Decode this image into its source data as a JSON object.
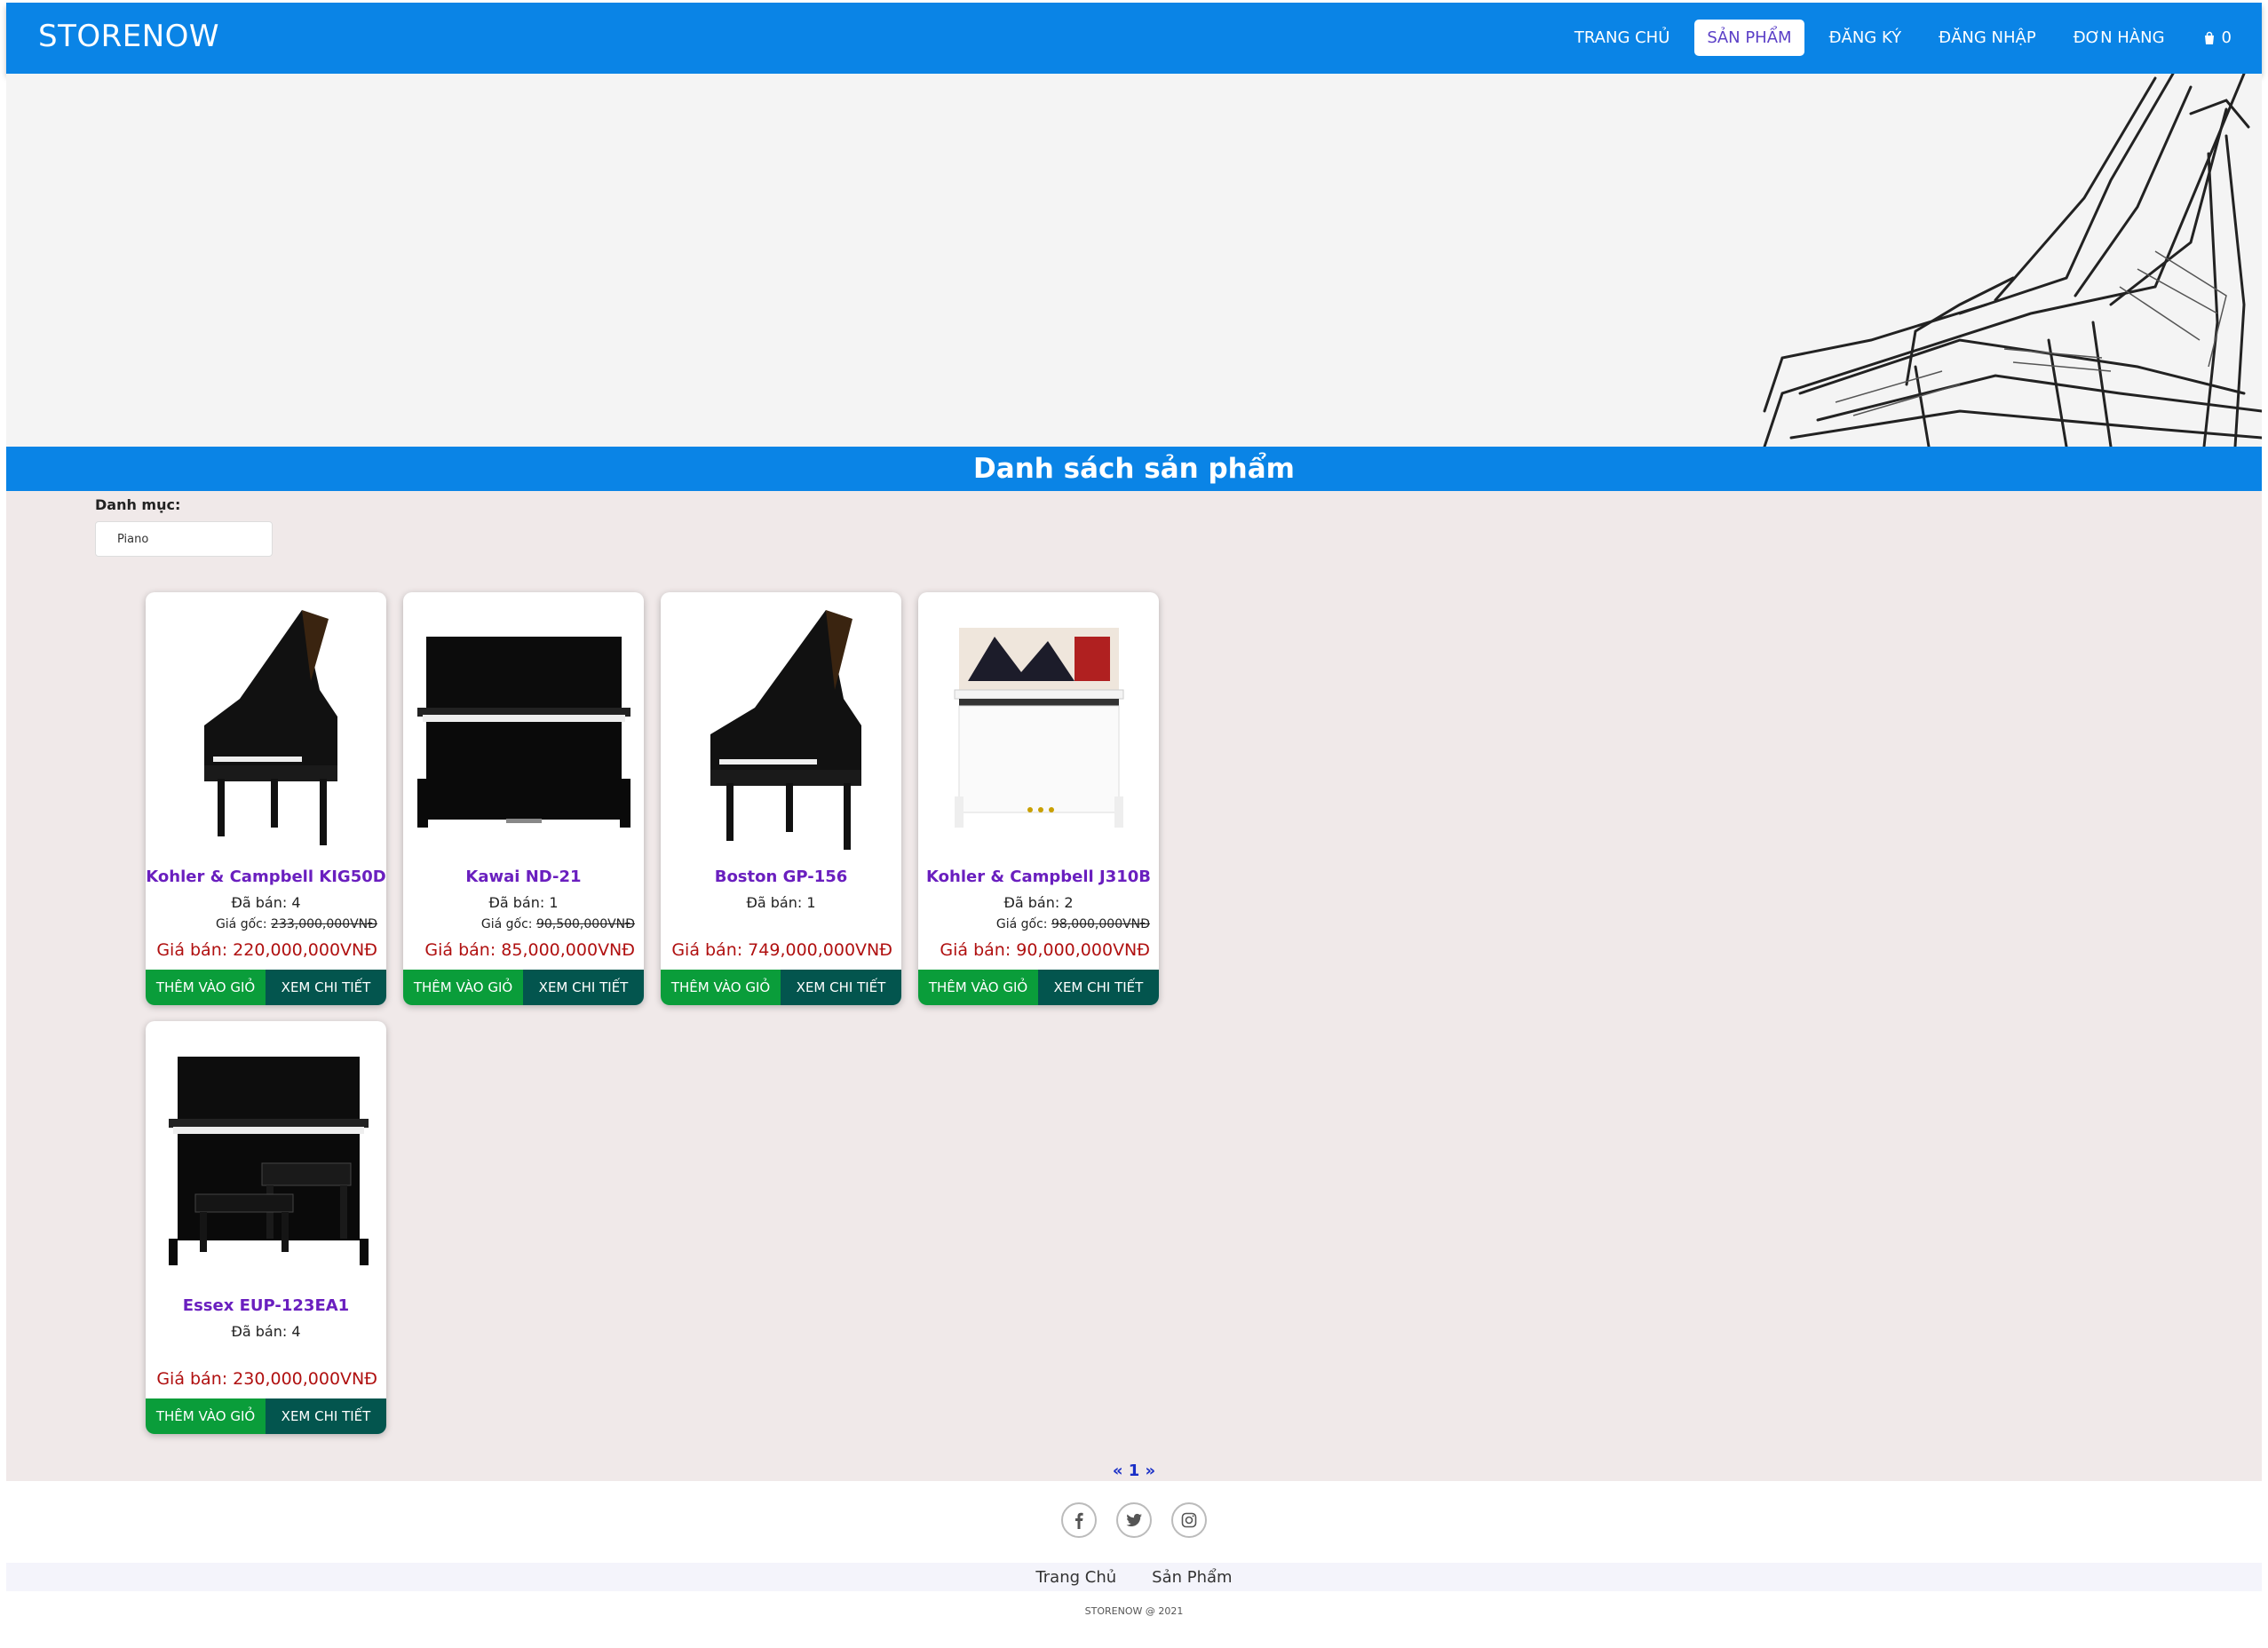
{
  "navbar": {
    "brand": "STORENOW",
    "items": [
      {
        "label": "TRANG CHỦ"
      },
      {
        "label": "SẢN PHẨM"
      },
      {
        "label": "ĐĂNG KÝ"
      },
      {
        "label": "ĐĂNG NHẬP"
      },
      {
        "label": "ĐƠN HÀNG"
      }
    ],
    "cart_count": "0",
    "active_index": 1
  },
  "page_title": "Danh sách sản phẩm",
  "filter": {
    "label": "Danh mục:",
    "value": "Piano"
  },
  "products": [
    {
      "name": "Kohler & Campbell KIG50D",
      "sold": "Đã bán: 4",
      "orig_label": "Giá gốc:",
      "orig_price": "233,000,000VNĐ",
      "price": "Giá bán: 220,000,000VNĐ",
      "image_icon": "grand-piano-icon"
    },
    {
      "name": "Kawai ND-21",
      "sold": "Đã bán: 1",
      "orig_label": "Giá gốc:",
      "orig_price": "90,500,000VNĐ",
      "price": "Giá bán: 85,000,000VNĐ",
      "image_icon": "upright-piano-icon"
    },
    {
      "name": "Boston GP-156",
      "sold": "Đã bán: 1",
      "orig_label": "",
      "orig_price": "",
      "price": "Giá bán: 749,000,000VNĐ",
      "image_icon": "grand-piano-icon"
    },
    {
      "name": "Kohler & Campbell J310B",
      "sold": "Đã bán: 2",
      "orig_label": "Giá gốc:",
      "orig_price": "98,000,000VNĐ",
      "price": "Giá bán: 90,000,000VNĐ",
      "image_icon": "white-upright-piano-icon"
    },
    {
      "name": "Essex EUP-123EA1",
      "sold": "Đã bán: 4",
      "orig_label": "",
      "orig_price": "",
      "price": "Giá bán: 230,000,000VNĐ",
      "image_icon": "upright-piano-bench-icon"
    }
  ],
  "card_buttons": {
    "add": "THÊM VÀO GIỎ",
    "view": "XEM CHI TIẾT"
  },
  "pagination": "« 1 »",
  "social_icons": [
    "facebook-icon",
    "twitter-icon",
    "instagram-icon"
  ],
  "footer": {
    "links": [
      "Trang Chủ",
      "Sản Phẩm"
    ],
    "copyright": "STORENOW @ 2021"
  },
  "colors": {
    "primary": "#0a84e6",
    "add_button": "#0a9d3a",
    "view_button": "#03554e",
    "product_name": "#6a1fbf",
    "price": "#b01010"
  }
}
